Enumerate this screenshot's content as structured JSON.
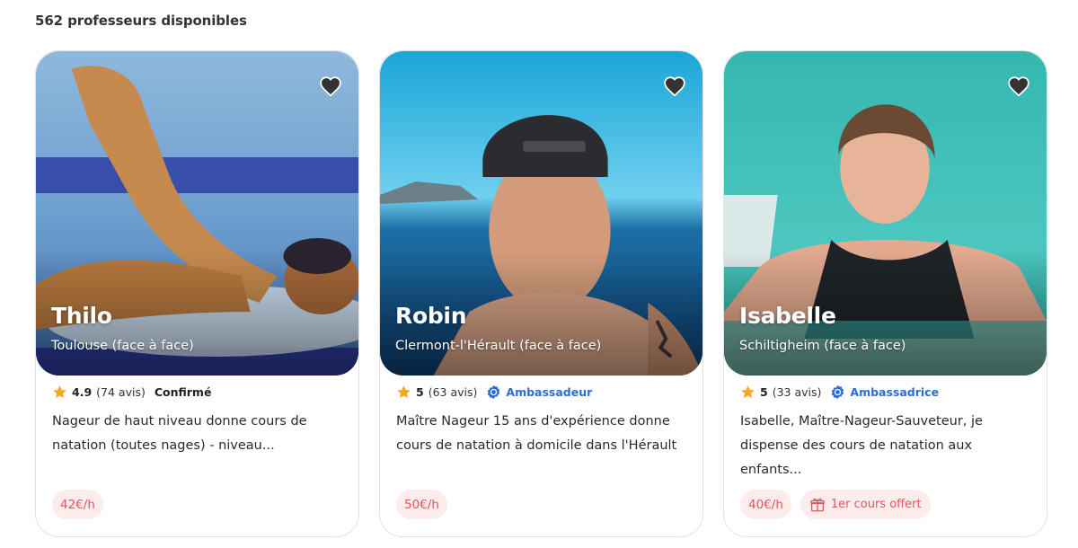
{
  "results": {
    "count_label": "562 professeurs disponibles"
  },
  "colors": {
    "accent_blue": "#2b6fd6",
    "price_text": "#e0565f",
    "price_bg": "#fdecec",
    "star": "#f5a623"
  },
  "tutors": [
    {
      "name": "Thilo",
      "location": "Toulouse (face à face)",
      "rating": "4.9",
      "reviews": "(74 avis)",
      "level": "Confirmé",
      "description": "Nageur de haut niveau donne cours de natation (toutes nages) - niveau...",
      "price": "42€/h",
      "favorite_icon": "heart-icon"
    },
    {
      "name": "Robin",
      "location": "Clermont-l'Hérault (face à face)",
      "rating": "5",
      "reviews": "(63 avis)",
      "badge": "Ambassadeur",
      "description": "Maître Nageur 15 ans d'expérience donne cours de natation à domicile dans l'Hérault",
      "price": "50€/h",
      "favorite_icon": "heart-icon"
    },
    {
      "name": "Isabelle",
      "location": "Schiltigheim (face à face)",
      "rating": "5",
      "reviews": "(33 avis)",
      "badge": "Ambassadrice",
      "description": "Isabelle, Maître-Nageur-Sauveteur, je dispense des cours de natation aux enfants...",
      "price": "40€/h",
      "offer": "1er cours offert",
      "favorite_icon": "heart-icon"
    }
  ]
}
